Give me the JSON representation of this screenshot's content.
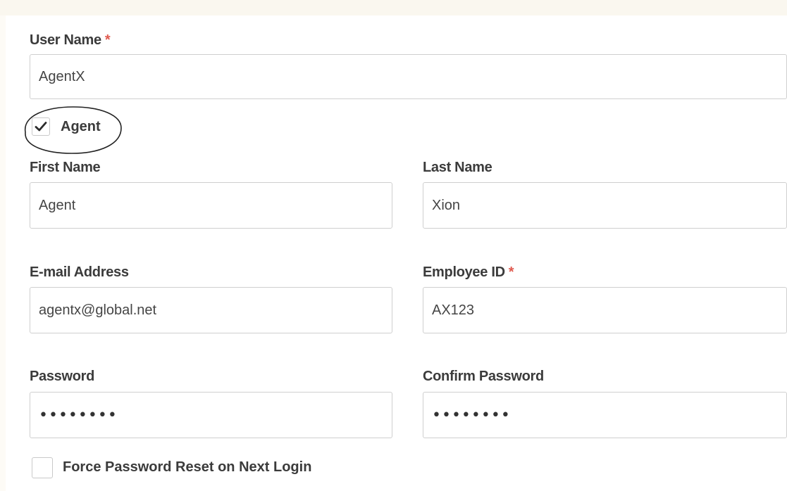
{
  "form": {
    "user_name": {
      "label": "User Name",
      "required_mark": "*",
      "value": "AgentX"
    },
    "agent_checkbox": {
      "label": "Agent",
      "checked": true
    },
    "first_name": {
      "label": "First Name",
      "value": "Agent"
    },
    "last_name": {
      "label": "Last Name",
      "value": "Xion"
    },
    "email": {
      "label": "E-mail Address",
      "value": "agentx@global.net"
    },
    "employee_id": {
      "label": "Employee ID",
      "required_mark": "*",
      "value": "AX123"
    },
    "password": {
      "label": "Password",
      "masked_value": "••••••••"
    },
    "confirm_password": {
      "label": "Confirm Password",
      "masked_value": "••••••••"
    },
    "force_reset": {
      "label": "Force Password Reset on Next Login",
      "checked": false
    }
  },
  "colors": {
    "required_asterisk": "#e05a4f",
    "field_border": "#cfcfcf",
    "label_text": "#3b3b3b",
    "background": "#fdfbf6"
  },
  "icons": {
    "agent_check": "checkmark-icon",
    "annotation": "hand-drawn-ellipse"
  }
}
